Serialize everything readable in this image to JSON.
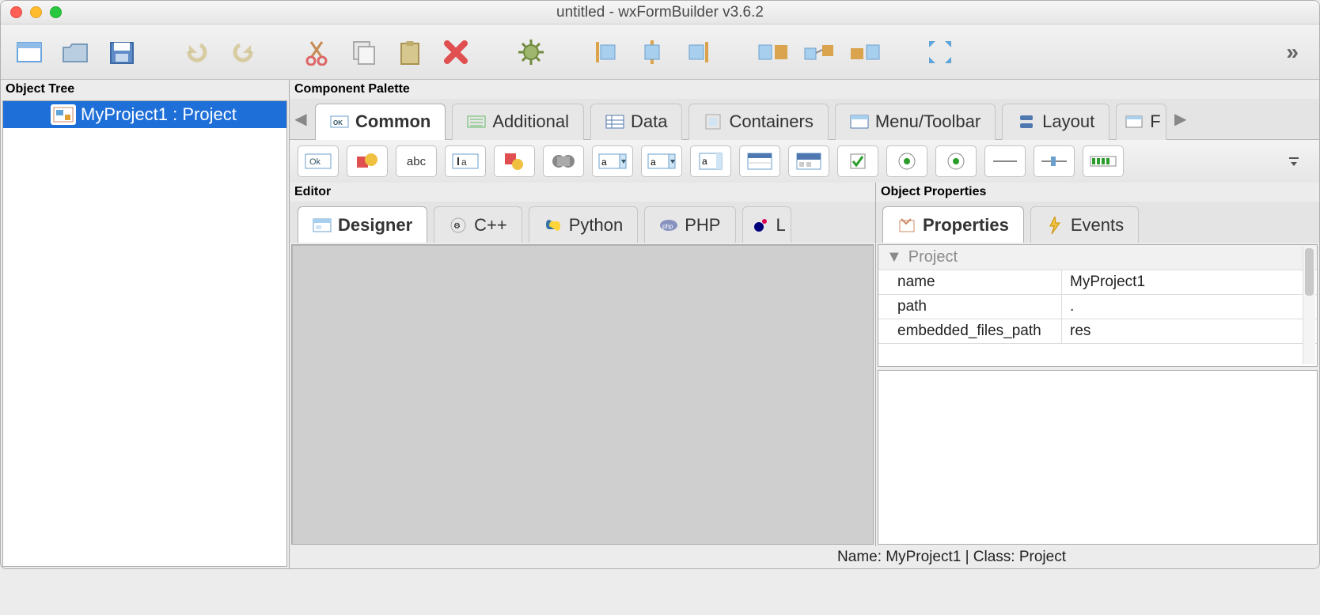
{
  "window": {
    "title": "untitled - wxFormBuilder v3.6.2"
  },
  "toolbar_icons": {
    "new": "new-file-icon",
    "open": "open-folder-icon",
    "save": "save-icon",
    "undo": "undo-icon",
    "redo": "redo-icon",
    "cut": "cut-icon",
    "copy": "copy-icon",
    "paste": "paste-icon",
    "delete": "delete-icon",
    "settings": "gear-icon",
    "align_left": "align-left-icon",
    "align_center": "align-center-icon",
    "align_right": "align-right-icon",
    "layout1": "layout-h-icon",
    "layout2": "layout-swap-icon",
    "layout3": "layout-v-icon",
    "expand": "expand-icon"
  },
  "panels": {
    "object_tree": "Object Tree",
    "component_palette": "Component Palette",
    "editor": "Editor",
    "object_properties": "Object Properties"
  },
  "tree": {
    "selected": "MyProject1 : Project"
  },
  "palette_tabs": [
    {
      "label": "Common",
      "active": true
    },
    {
      "label": "Additional",
      "active": false
    },
    {
      "label": "Data",
      "active": false
    },
    {
      "label": "Containers",
      "active": false
    },
    {
      "label": "Menu/Toolbar",
      "active": false
    },
    {
      "label": "Layout",
      "active": false
    },
    {
      "label": "F",
      "active": false
    }
  ],
  "palette_items": [
    "Ok",
    "img",
    "abc",
    "a|",
    "shp",
    "film",
    "a|1",
    "a|2",
    "a3",
    "list",
    "tool",
    "chk",
    "rad1",
    "rad2",
    "line",
    "slider",
    "gauge"
  ],
  "editor_tabs": [
    {
      "label": "Designer",
      "active": true
    },
    {
      "label": "C++",
      "active": false
    },
    {
      "label": "Python",
      "active": false
    },
    {
      "label": "PHP",
      "active": false
    },
    {
      "label": "L",
      "active": false
    }
  ],
  "props_tabs": [
    {
      "label": "Properties",
      "active": true
    },
    {
      "label": "Events",
      "active": false
    }
  ],
  "properties": {
    "group": "Project",
    "rows": [
      {
        "key": "name",
        "value": "MyProject1"
      },
      {
        "key": "path",
        "value": "."
      },
      {
        "key": "embedded_files_path",
        "value": "res"
      }
    ]
  },
  "status": "Name: MyProject1 | Class: Project"
}
